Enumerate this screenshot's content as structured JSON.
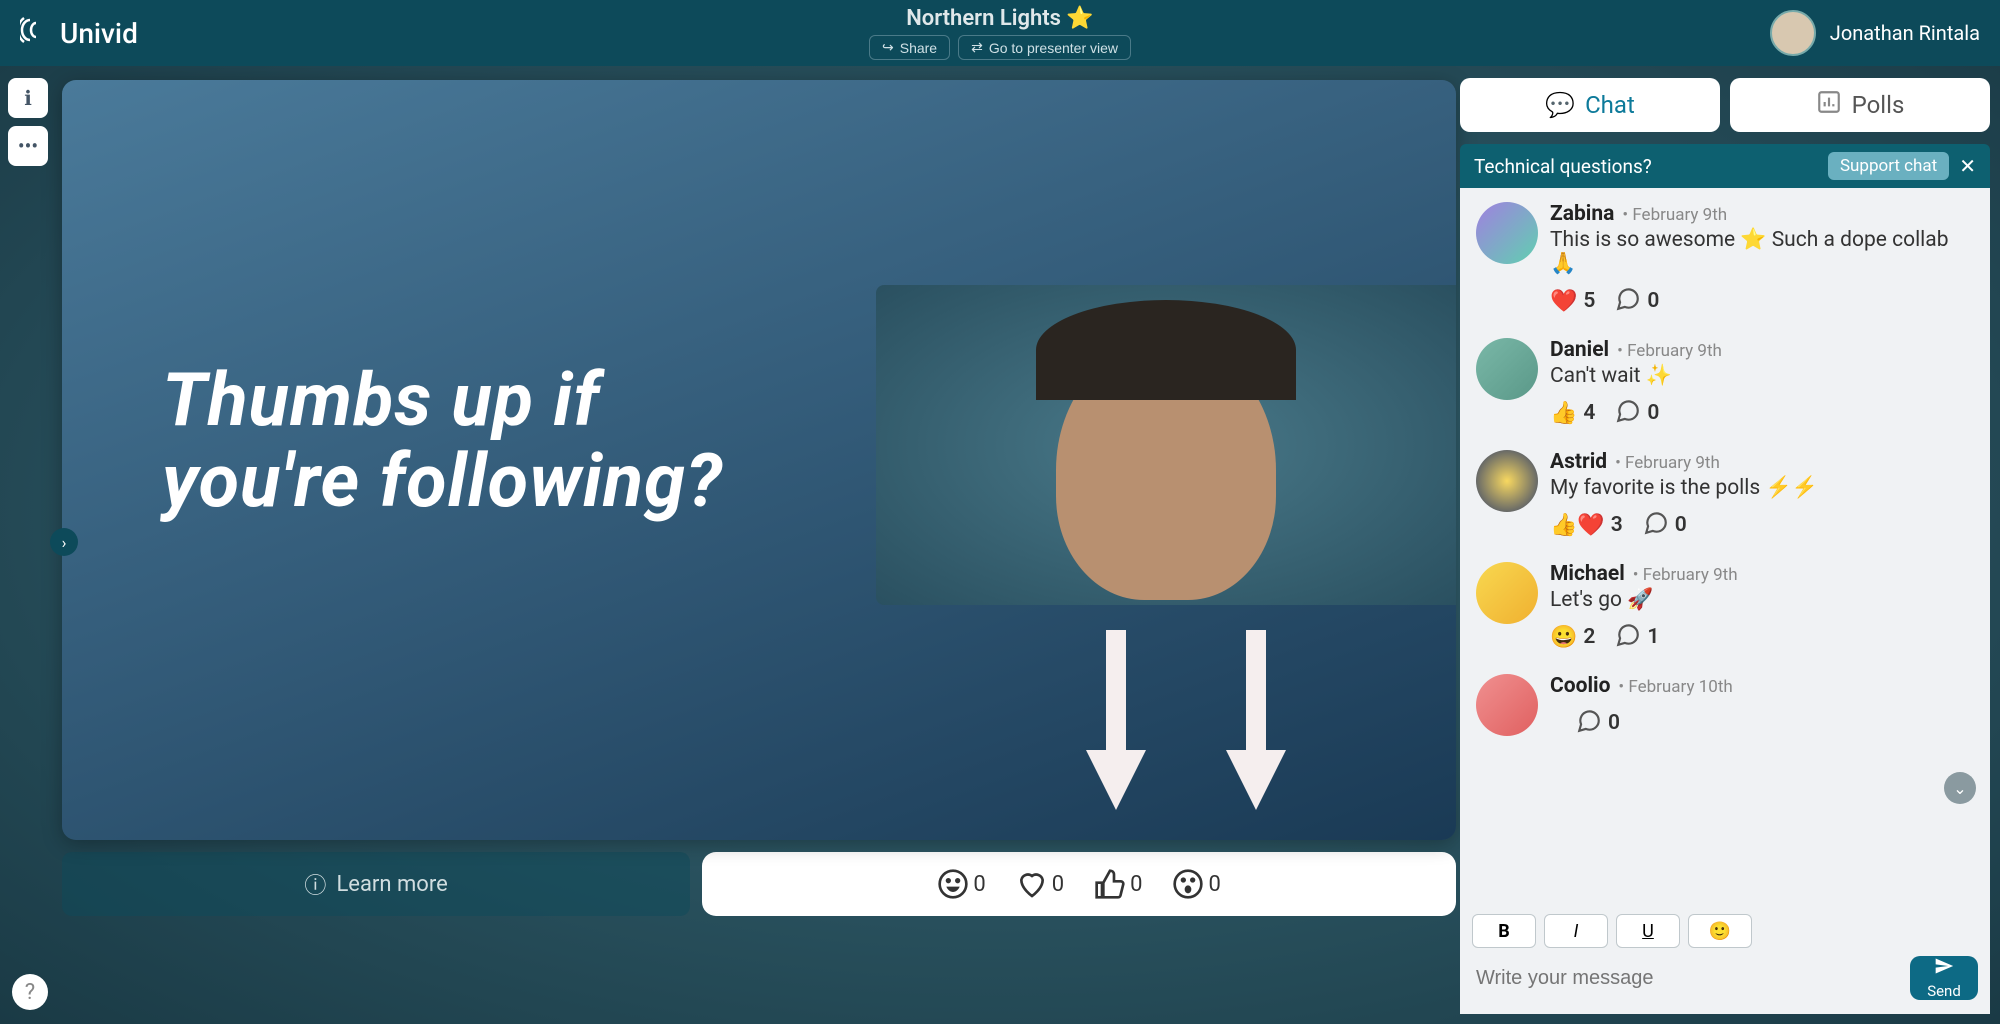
{
  "header": {
    "brand": "Univid",
    "title": "Northern Lights ⭐",
    "share": "Share",
    "presenter_view": "Go to presenter view",
    "user_name": "Jonathan Rintala"
  },
  "slide": {
    "line1": "Thumbs up if",
    "line2": "you're following?"
  },
  "learn_more": "Learn more",
  "reactions": [
    {
      "key": "grin",
      "count": 0
    },
    {
      "key": "heart",
      "count": 0
    },
    {
      "key": "thumbs",
      "count": 0
    },
    {
      "key": "wow",
      "count": 0
    }
  ],
  "tabs": {
    "chat": "Chat",
    "polls": "Polls"
  },
  "support": {
    "question": "Technical questions?",
    "chip": "Support chat"
  },
  "messages": [
    {
      "name": "Zabina",
      "date": "February 9th",
      "text": "This is so awesome ⭐ Such a dope collab 🙏",
      "react_icon": "❤️",
      "react_count": 5,
      "reply_count": 0,
      "avatar": "linear-gradient(135deg,#a080e0,#60d0b0)"
    },
    {
      "name": "Daniel",
      "date": "February 9th",
      "text": "Can't wait ✨",
      "react_icon": "👍",
      "react_count": 4,
      "reply_count": 0,
      "avatar": "linear-gradient(135deg,#7ab8a8,#5a9888)"
    },
    {
      "name": "Astrid",
      "date": "February 9th",
      "text": "My favorite is the polls ⚡⚡",
      "react_icon": "👍❤️",
      "react_count": 3,
      "reply_count": 0,
      "avatar": "radial-gradient(circle,#f8d860,#2a3a6a)"
    },
    {
      "name": "Michael",
      "date": "February 9th",
      "text": "Let's go 🚀",
      "react_icon": "😀",
      "react_count": 2,
      "reply_count": 1,
      "avatar": "linear-gradient(135deg,#f8d850,#f0b030)"
    },
    {
      "name": "Coolio",
      "date": "February 10th",
      "text": "",
      "react_icon": "",
      "react_count": 0,
      "reply_count": 0,
      "avatar": "linear-gradient(135deg,#f09090,#e06060)"
    }
  ],
  "compose": {
    "bold": "B",
    "italic": "I",
    "underline": "U",
    "emoji": "🙂",
    "placeholder": "Write your message",
    "send": "Send"
  }
}
